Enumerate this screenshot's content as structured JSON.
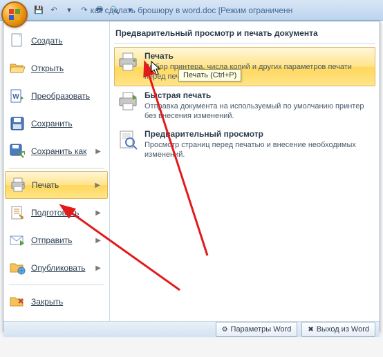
{
  "titlebar": {
    "title": "как сделать брошюру в word.doc [Режим ограниченн"
  },
  "qat": {
    "save": "💾",
    "undo": "↶",
    "redo": "↷",
    "print": "🖶",
    "preview": "🔍",
    "drop": "▾"
  },
  "left": [
    {
      "key": "new",
      "label": "Создать",
      "arrow": false
    },
    {
      "key": "open",
      "label": "Открыть",
      "arrow": false
    },
    {
      "key": "convert",
      "label": "Преобразовать",
      "arrow": false
    },
    {
      "key": "save",
      "label": "Сохранить",
      "arrow": false
    },
    {
      "key": "saveas",
      "label": "Сохранить как",
      "arrow": true
    },
    {
      "key": "print",
      "label": "Печать",
      "arrow": true,
      "hover": true
    },
    {
      "key": "prepare",
      "label": "Подготовить",
      "arrow": true
    },
    {
      "key": "send",
      "label": "Отправить",
      "arrow": true
    },
    {
      "key": "publish",
      "label": "Опубликовать",
      "arrow": true
    },
    {
      "key": "close",
      "label": "Закрыть",
      "arrow": false
    }
  ],
  "right": {
    "header": "Предварительный просмотр и печать документа",
    "items": [
      {
        "key": "print",
        "title": "Печать",
        "desc": "Выбор принтера, числа копий и других параметров печати перед печатью.",
        "hover": true
      },
      {
        "key": "quick-print",
        "title": "Быстрая печать",
        "desc": "Отправка документа на используемый по умолчанию принтер без внесения изменений."
      },
      {
        "key": "preview",
        "title": "Предварительный просмотр",
        "desc": "Просмотр страниц перед печатью и внесение необходимых изменений."
      }
    ]
  },
  "tooltip": "Печать (Ctrl+P)",
  "footer": {
    "options": "Параметры Word",
    "exit": "Выход из Word"
  }
}
